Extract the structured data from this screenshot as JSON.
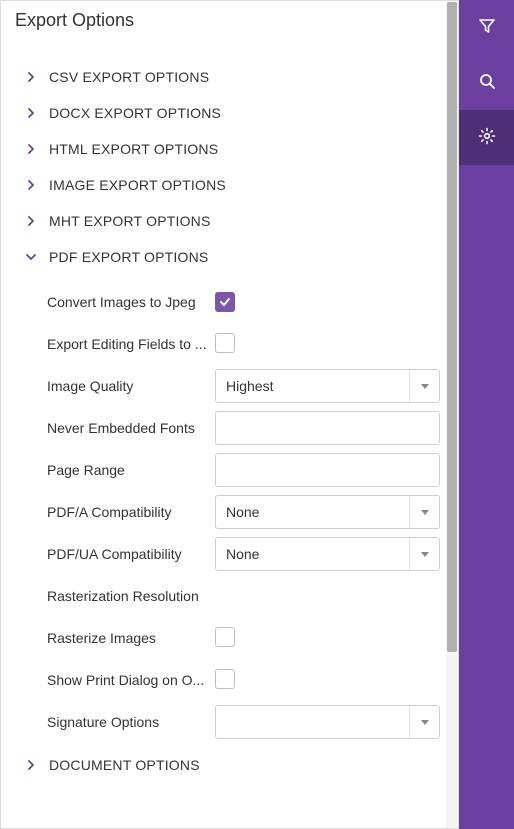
{
  "panel": {
    "title": "Export Options"
  },
  "sections": {
    "csv": {
      "label": "CSV Export Options"
    },
    "docx": {
      "label": "DOCX Export Options"
    },
    "html": {
      "label": "HTML Export Options"
    },
    "image": {
      "label": "Image Export Options"
    },
    "mht": {
      "label": "MHT Export Options"
    },
    "pdf": {
      "label": "PDF Export Options"
    },
    "document": {
      "label": "Document Options"
    }
  },
  "pdf": {
    "convert_images_to_jpeg": {
      "label": "Convert Images to Jpeg",
      "checked": true
    },
    "export_editing_fields": {
      "label": "Export Editing Fields to ...",
      "checked": false
    },
    "image_quality": {
      "label": "Image Quality",
      "value": "Highest"
    },
    "never_embedded_fonts": {
      "label": "Never Embedded Fonts",
      "value": ""
    },
    "page_range": {
      "label": "Page Range",
      "value": ""
    },
    "pdfa_compat": {
      "label": "PDF/A Compatibility",
      "value": "None"
    },
    "pdfua_compat": {
      "label": "PDF/UA Compatibility",
      "value": "None"
    },
    "rasterization_resolution": {
      "label": "Rasterization Resolution"
    },
    "rasterize_images": {
      "label": "Rasterize Images",
      "checked": false
    },
    "show_print_dialog": {
      "label": "Show Print Dialog on O...",
      "checked": false
    },
    "signature_options": {
      "label": "Signature Options",
      "value": ""
    }
  },
  "sidebar": {
    "filter": "filter",
    "search": "search",
    "settings": "settings"
  }
}
